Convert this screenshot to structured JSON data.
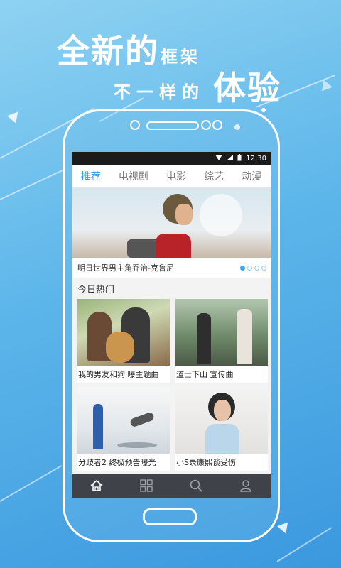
{
  "promo": {
    "line1_big": "全新的",
    "line1_small": "框架",
    "line2_small": "不一样的",
    "line2_big": "体验"
  },
  "statusbar": {
    "time": "12:30"
  },
  "tabs": [
    {
      "label": "推荐",
      "active": true
    },
    {
      "label": "电视剧",
      "active": false
    },
    {
      "label": "电影",
      "active": false
    },
    {
      "label": "综艺",
      "active": false
    },
    {
      "label": "动漫",
      "active": false
    }
  ],
  "banner": {
    "caption": "明日世界男主角乔治-克鲁尼",
    "indicator": {
      "count": 4,
      "active": 1
    }
  },
  "section": {
    "title": "今日热门"
  },
  "cards": [
    {
      "title": "我的男友和狗  曝主题曲"
    },
    {
      "title": "道士下山 宣传曲"
    },
    {
      "title": "分歧者2 终极预告曝光"
    },
    {
      "title": "小S录康熙谈受伤"
    }
  ],
  "bottom_nav": [
    {
      "icon": "home-icon",
      "active": true
    },
    {
      "icon": "grid-icon",
      "active": false
    },
    {
      "icon": "search-icon",
      "active": false
    },
    {
      "icon": "user-icon",
      "active": false
    }
  ],
  "colors": {
    "accent": "#3aa0e5",
    "nav_bg": "#3f4248",
    "background": "#5db6ea"
  }
}
